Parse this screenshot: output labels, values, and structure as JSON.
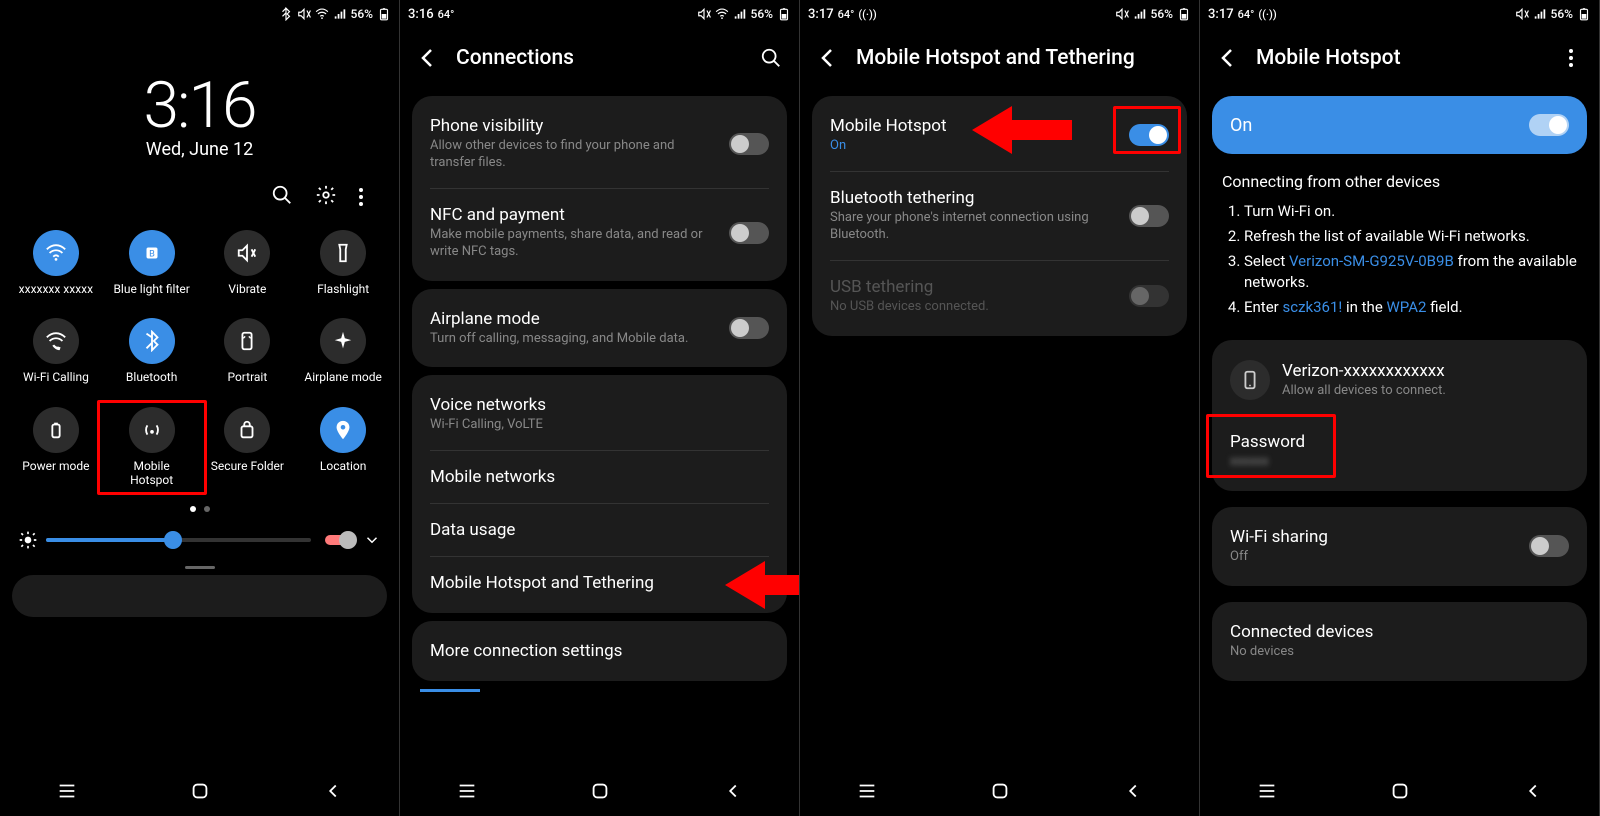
{
  "p1": {
    "status": {
      "time": "",
      "battery": "56%"
    },
    "bigtime": "3:16",
    "bigdate": "Wed, June 12",
    "tiles": [
      {
        "label": "xxxxxxx xxxxx",
        "on": true,
        "icon": "wifi"
      },
      {
        "label": "Blue light filter",
        "on": true,
        "icon": "bluelight"
      },
      {
        "label": "Vibrate",
        "on": false,
        "icon": "vibrate"
      },
      {
        "label": "Flashlight",
        "on": false,
        "icon": "flashlight"
      },
      {
        "label": "Wi-Fi Calling",
        "on": false,
        "icon": "wificalling"
      },
      {
        "label": "Bluetooth",
        "on": true,
        "icon": "bluetooth"
      },
      {
        "label": "Portrait",
        "on": false,
        "icon": "portrait"
      },
      {
        "label": "Airplane mode",
        "on": false,
        "icon": "airplane"
      },
      {
        "label": "Power mode",
        "on": false,
        "icon": "power"
      },
      {
        "label": "Mobile Hotspot",
        "on": false,
        "icon": "hotspot",
        "highlight": true
      },
      {
        "label": "Secure Folder",
        "on": false,
        "icon": "secure"
      },
      {
        "label": "Location",
        "on": true,
        "icon": "location"
      }
    ]
  },
  "p2": {
    "status": {
      "time": "3:16",
      "temp": "64°",
      "battery": "56%"
    },
    "title": "Connections",
    "sections": [
      {
        "rows": [
          {
            "title": "Phone visibility",
            "sub": "Allow other devices to find your phone and transfer files.",
            "toggle": true,
            "on": false
          },
          {
            "title": "NFC and payment",
            "sub": "Make mobile payments, share data, and read or write NFC tags.",
            "toggle": true,
            "on": false
          }
        ]
      },
      {
        "rows": [
          {
            "title": "Airplane mode",
            "sub": "Turn off calling, messaging, and Mobile data.",
            "toggle": true,
            "on": false
          }
        ]
      },
      {
        "rows": [
          {
            "title": "Voice networks",
            "sub": "Wi-Fi Calling, VoLTE"
          },
          {
            "title": "Mobile networks"
          },
          {
            "title": "Data usage"
          },
          {
            "title": "Mobile Hotspot and Tethering",
            "arrow": true
          }
        ]
      },
      {
        "rows": [
          {
            "title": "More connection settings"
          }
        ]
      }
    ]
  },
  "p3": {
    "status": {
      "time": "3:17",
      "temp": "64°",
      "battery": "56%"
    },
    "title": "Mobile Hotspot and Tethering",
    "rows": [
      {
        "title": "Mobile Hotspot",
        "sub": "On",
        "subblue": true,
        "toggle": true,
        "on": true,
        "highlight_toggle": true,
        "arrow": true
      },
      {
        "title": "Bluetooth tethering",
        "sub": "Share your phone's internet connection using Bluetooth.",
        "toggle": true,
        "on": false
      },
      {
        "title": "USB tethering",
        "sub": "No USB devices connected.",
        "toggle": true,
        "on": false,
        "disabled": true
      }
    ]
  },
  "p4": {
    "status": {
      "time": "3:17",
      "temp": "64°",
      "battery": "56%"
    },
    "title": "Mobile Hotspot",
    "onlabel": "On",
    "instr": {
      "heading": "Connecting from other devices",
      "step1": "Turn Wi-Fi on.",
      "step2": "Refresh the list of available Wi-Fi networks.",
      "step3a": "Select ",
      "step3link": "Verizon-SM-G925V-0B9B",
      "step3b": " from the available networks.",
      "step4a": "Enter ",
      "step4pw": "sczk361!",
      "step4b": " in the ",
      "step4wpa": "WPA2",
      "step4c": " field."
    },
    "net": {
      "name": "Verizon-xxxxxxxxxxxx",
      "sub": "Allow all devices to connect."
    },
    "pw": {
      "label": "Password",
      "value": "xxxxxx"
    },
    "wifishare": {
      "label": "Wi-Fi sharing",
      "sub": "Off"
    },
    "conn": {
      "label": "Connected devices",
      "sub": "No devices"
    }
  }
}
